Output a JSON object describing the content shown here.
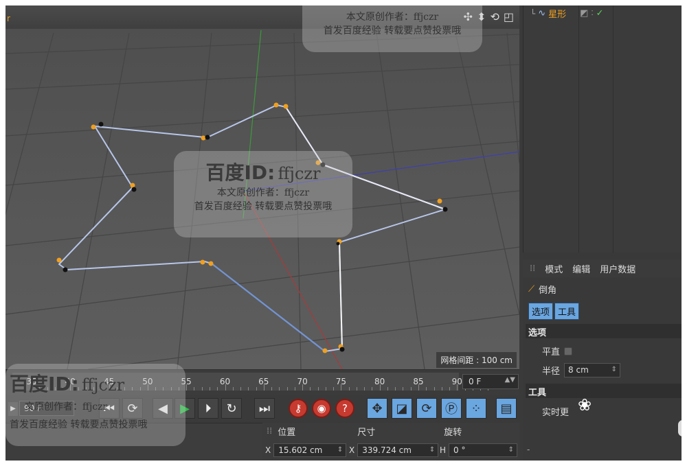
{
  "viewport": {
    "corner_label": "r",
    "grid_spacing_label": "网格间距 : 100 cm",
    "nav_icons": [
      "move-view-icon",
      "dolly-icon",
      "rotate-view-icon",
      "maximize-view-icon"
    ]
  },
  "timeline": {
    "ticks": [
      "35",
      "40",
      "45",
      "50",
      "55",
      "60",
      "65",
      "70",
      "75",
      "80",
      "85",
      "90"
    ],
    "current_frame": "0 F"
  },
  "transport": {
    "start_field": "90 F",
    "buttons": [
      "prev-key",
      "record",
      "step-back",
      "play",
      "step-forward",
      "loop",
      "go-end",
      "record-active",
      "autokey",
      "keyframe-help",
      "move-key",
      "scale-key",
      "rotate-key",
      "param-key",
      "point-key",
      "film"
    ]
  },
  "coordinates": {
    "headers": [
      "位置",
      "尺寸",
      "旋转"
    ],
    "x_label": "X",
    "x_position": "15.602 cm",
    "x_size": "339.724 cm",
    "h_label": "H",
    "h_rotation": "0 °"
  },
  "object_manager": {
    "object_name": "星形"
  },
  "attributes": {
    "tabs": [
      "模式",
      "编辑",
      "用户数据"
    ],
    "tool_name": "倒角",
    "subtabs": [
      "选项",
      "工具"
    ],
    "section_options": "选项",
    "flat_label": "平直",
    "radius_label": "半径",
    "radius_value": "8 cm",
    "section_tool": "工具",
    "realtime_label": "实时更"
  },
  "watermark": {
    "brand": "百度",
    "id_label": "ID:",
    "author_id": "ffjczr",
    "line1": "本文原创作者：ffjczr",
    "line2": "首发百度经验  转载要点赞投票哦",
    "line1_partial": "文原创作者：ffjczr"
  },
  "colors": {
    "accent_blue": "#6aa6e0",
    "spline_point": "#f0a020",
    "record_red": "#c73a2f",
    "play_green": "#2ec04a"
  }
}
